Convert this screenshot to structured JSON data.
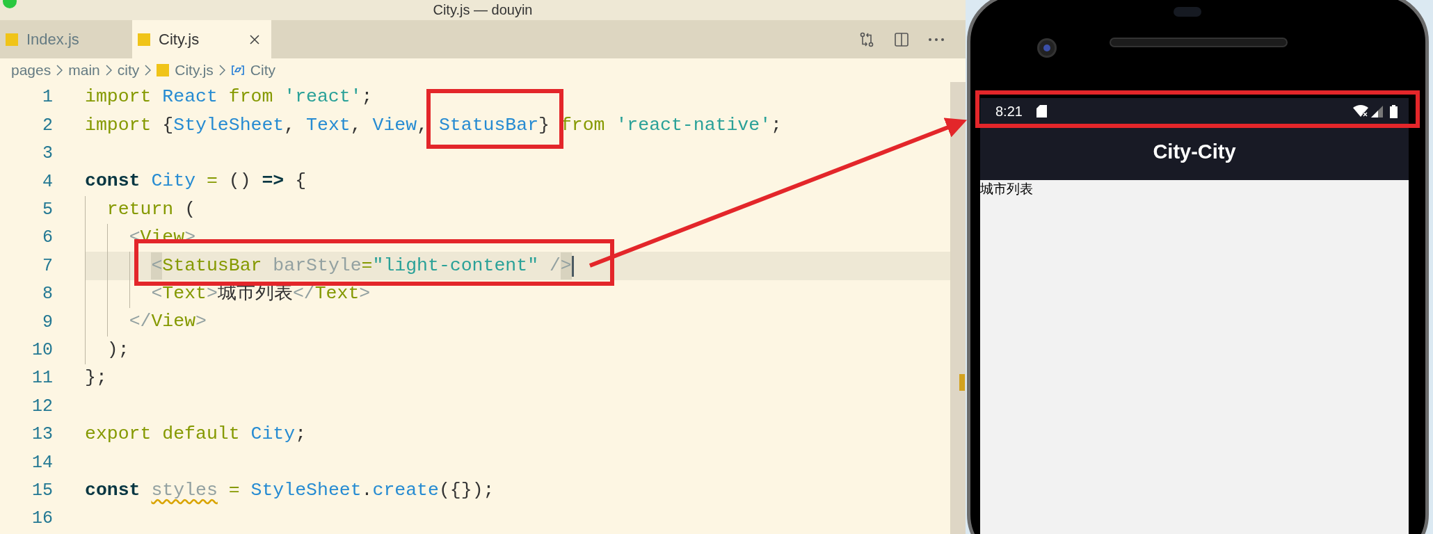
{
  "window": {
    "title": "City.js — douyin"
  },
  "tabs": [
    {
      "label": "Index.js",
      "selected": false
    },
    {
      "label": "City.js",
      "selected": true
    }
  ],
  "breadcrumb": [
    {
      "label": "pages",
      "kind": "folder"
    },
    {
      "label": "main",
      "kind": "folder"
    },
    {
      "label": "city",
      "kind": "folder"
    },
    {
      "label": "City.js",
      "kind": "file"
    },
    {
      "label": "City",
      "kind": "symbol"
    }
  ],
  "code": {
    "lines": [
      {
        "number": "1",
        "current": false,
        "tokens": [
          {
            "text": "import",
            "kind": "keyword"
          },
          {
            "text": " React",
            "kind": "ident"
          },
          {
            "text": " from",
            "kind": "keyword"
          },
          {
            "text": " 'react'",
            "kind": "string"
          },
          {
            "text": ";",
            "kind": "plain"
          }
        ]
      },
      {
        "number": "2",
        "current": false,
        "tokens": [
          {
            "text": "import",
            "kind": "keyword"
          },
          {
            "text": " {",
            "kind": "plain"
          },
          {
            "text": "StyleSheet",
            "kind": "ident"
          },
          {
            "text": ", ",
            "kind": "plain"
          },
          {
            "text": "Text",
            "kind": "ident"
          },
          {
            "text": ", ",
            "kind": "plain"
          },
          {
            "text": "View",
            "kind": "ident"
          },
          {
            "text": ", ",
            "kind": "plain"
          },
          {
            "text": "StatusBar",
            "kind": "ident"
          },
          {
            "text": "} ",
            "kind": "plain"
          },
          {
            "text": "from",
            "kind": "keyword"
          },
          {
            "text": " 'react-native'",
            "kind": "string"
          },
          {
            "text": ";",
            "kind": "plain"
          }
        ]
      },
      {
        "number": "3",
        "current": false
      },
      {
        "number": "4",
        "current": false,
        "tokens": [
          {
            "text": "const",
            "kind": "decl"
          },
          {
            "text": " City",
            "kind": "ident"
          },
          {
            "text": " =",
            "kind": "keyword"
          },
          {
            "text": " () ",
            "kind": "plain"
          },
          {
            "text": "=>",
            "kind": "decl"
          },
          {
            "text": " {",
            "kind": "plain"
          }
        ]
      },
      {
        "number": "5",
        "current": false,
        "tokens": [
          {
            "text": "  return",
            "kind": "keyword"
          },
          {
            "text": " (",
            "kind": "plain"
          }
        ]
      },
      {
        "number": "6",
        "current": false,
        "tokens": [
          {
            "text": "    <",
            "kind": "muted"
          },
          {
            "text": "View",
            "kind": "tag"
          },
          {
            "text": ">",
            "kind": "muted"
          }
        ]
      },
      {
        "number": "7",
        "current": true,
        "tokens": [
          {
            "text": "      <",
            "kind": "match"
          },
          {
            "text": "StatusBar",
            "kind": "tag"
          },
          {
            "text": " barStyle",
            "kind": "muted"
          },
          {
            "text": "=",
            "kind": "keyword"
          },
          {
            "text": "\"light-content\"",
            "kind": "string"
          },
          {
            "text": " /",
            "kind": "muted"
          },
          {
            "text": ">",
            "kind": "match"
          }
        ]
      },
      {
        "number": "8",
        "current": false,
        "tokens": [
          {
            "text": "      <",
            "kind": "muted"
          },
          {
            "text": "Text",
            "kind": "tag"
          },
          {
            "text": ">",
            "kind": "muted"
          },
          {
            "text": "城市列表",
            "kind": "plain"
          },
          {
            "text": "</",
            "kind": "muted"
          },
          {
            "text": "Text",
            "kind": "tag"
          },
          {
            "text": ">",
            "kind": "muted"
          }
        ]
      },
      {
        "number": "9",
        "current": false,
        "tokens": [
          {
            "text": "    </",
            "kind": "muted"
          },
          {
            "text": "View",
            "kind": "tag"
          },
          {
            "text": ">",
            "kind": "muted"
          }
        ]
      },
      {
        "number": "10",
        "current": false,
        "tokens": [
          {
            "text": "  );",
            "kind": "plain"
          }
        ]
      },
      {
        "number": "11",
        "current": false,
        "tokens": [
          {
            "text": "};",
            "kind": "plain"
          }
        ]
      },
      {
        "number": "12",
        "current": false
      },
      {
        "number": "13",
        "current": false,
        "tokens": [
          {
            "text": "export default",
            "kind": "keyword"
          },
          {
            "text": " City",
            "kind": "ident"
          },
          {
            "text": ";",
            "kind": "plain"
          }
        ]
      },
      {
        "number": "14",
        "current": false
      },
      {
        "number": "15",
        "current": false,
        "tokens": [
          {
            "text": "const ",
            "kind": "decl"
          },
          {
            "text": "styles",
            "kind": "unused"
          },
          {
            "text": " =",
            "kind": "keyword"
          },
          {
            "text": " StyleSheet",
            "kind": "ident"
          },
          {
            "text": ".",
            "kind": "plain"
          },
          {
            "text": "create",
            "kind": "ident"
          },
          {
            "text": "({});",
            "kind": "plain"
          }
        ]
      },
      {
        "number": "16",
        "current": false
      }
    ]
  },
  "phone": {
    "status_bar": {
      "time": "8:21"
    },
    "app_bar": {
      "title": "City-City"
    },
    "content": {
      "text": "城市列表"
    }
  }
}
